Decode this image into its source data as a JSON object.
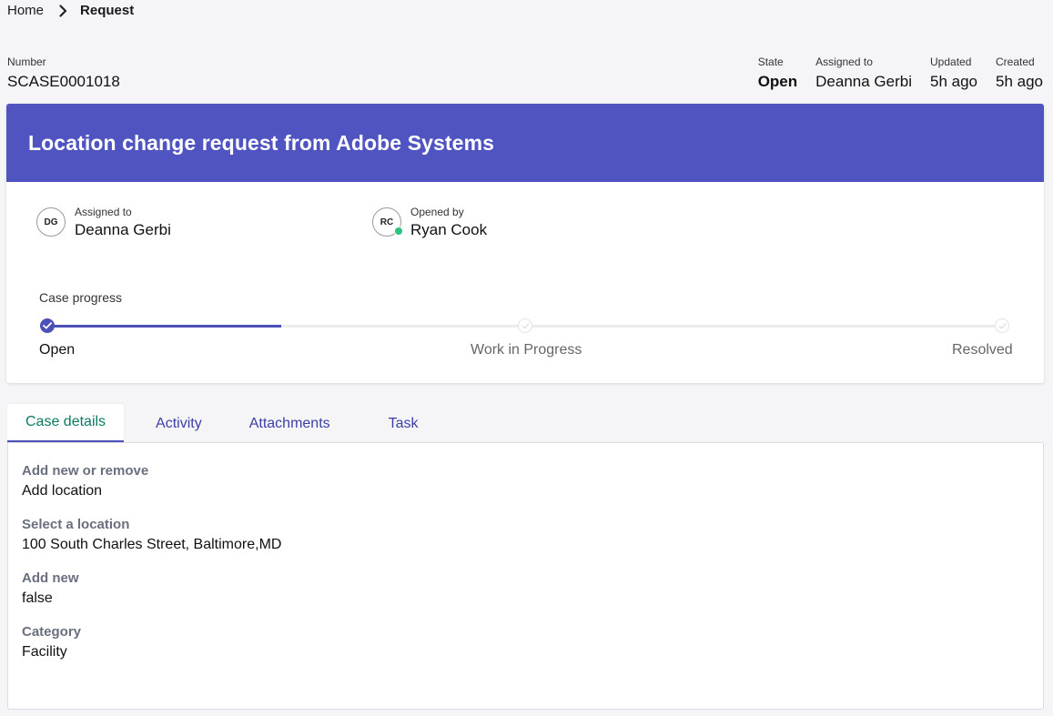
{
  "breadcrumb": {
    "home": "Home",
    "current": "Request"
  },
  "case": {
    "number_label": "Number",
    "number": "SCASE0001018",
    "title": "Location change request from Adobe Systems"
  },
  "meta": {
    "state_label": "State",
    "state": "Open",
    "assigned_label": "Assigned to",
    "assigned": "Deanna Gerbi",
    "updated_label": "Updated",
    "updated": "5h ago",
    "created_label": "Created",
    "created": "5h ago"
  },
  "people": {
    "assigned": {
      "label": "Assigned to",
      "name": "Deanna Gerbi",
      "initials": "DG"
    },
    "opened": {
      "label": "Opened by",
      "name": "Ryan Cook",
      "initials": "RC",
      "online": true
    }
  },
  "progress": {
    "title": "Case progress",
    "steps": [
      {
        "label": "Open",
        "status": "done"
      },
      {
        "label": "Work in Progress",
        "status": "pending"
      },
      {
        "label": "Resolved",
        "status": "pending"
      }
    ],
    "current_fill_fraction": 0.245
  },
  "tabs": [
    {
      "label": "Case details",
      "active": true
    },
    {
      "label": "Activity",
      "active": false
    },
    {
      "label": "Attachments",
      "active": false
    },
    {
      "label": "Task",
      "active": false
    }
  ],
  "details": [
    {
      "label": "Add new or remove",
      "value": "Add location"
    },
    {
      "label": "Select a location",
      "value": "100 South Charles Street, Baltimore,MD"
    },
    {
      "label": "Add new",
      "value": "false"
    },
    {
      "label": "Category",
      "value": "Facility"
    }
  ],
  "colors": {
    "banner": "#5054c0",
    "accent": "#4b4fb8",
    "active_tab_text": "#0b7a64",
    "online": "#2ec27e"
  }
}
